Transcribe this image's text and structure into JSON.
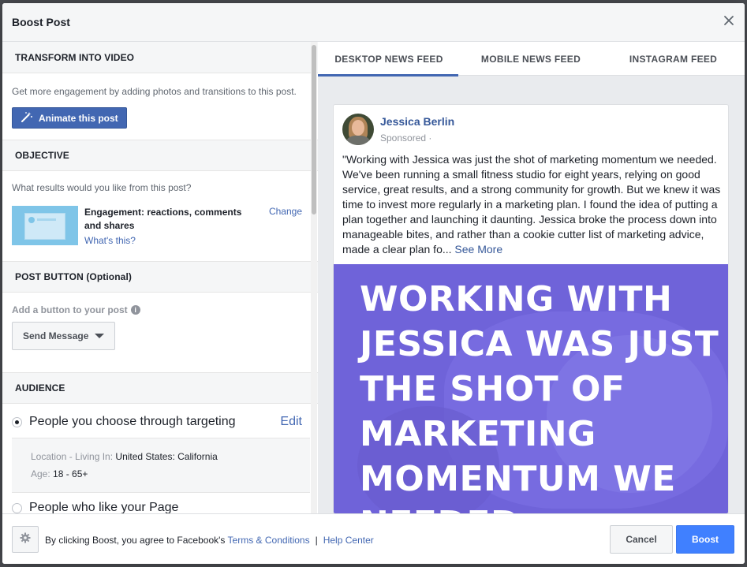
{
  "dialog": {
    "title": "Boost Post"
  },
  "transform": {
    "heading": "TRANSFORM INTO VIDEO",
    "description": "Get more engagement by adding photos and transitions to this post.",
    "animate_label": "Animate this post"
  },
  "objective": {
    "heading": "OBJECTIVE",
    "question": "What results would you like from this post?",
    "title": "Engagement: reactions, comments and shares",
    "whats_this": "What's this?",
    "change": "Change"
  },
  "post_button": {
    "heading": "POST BUTTON (Optional)",
    "label": "Add a button to your post",
    "selected": "Send Message"
  },
  "audience": {
    "heading": "AUDIENCE",
    "option1": "People you choose through targeting",
    "edit": "Edit",
    "location_key": "Location - Living In:",
    "location_value": "United States: California",
    "age_key": "Age:",
    "age_value": "18 - 65+",
    "option2": "People who like your Page"
  },
  "tabs": [
    "DESKTOP NEWS FEED",
    "MOBILE NEWS FEED",
    "INSTAGRAM FEED"
  ],
  "post": {
    "author": "Jessica Berlin",
    "meta": "Sponsored ·",
    "text": "\"Working with Jessica was just the shot of marketing momentum we needed. We've been running a small fitness studio for eight years, relying on good service, great results, and a strong community for growth. But we knew it was time to invest more regularly in a marketing plan. I found the idea of putting a plan together and launching it daunting. Jessica broke the process down into manageable bites, and rather than a cookie cutter list of marketing advice, made a clear plan fo...",
    "see_more": "See More",
    "image_text": "WORKING WITH JESSICA WAS JUST THE SHOT OF MARKETING MOMENTUM WE NEEDED"
  },
  "footer": {
    "agree_prefix": "By clicking Boost, you agree to Facebook's",
    "terms": "Terms & Conditions",
    "separator": "|",
    "help": "Help Center",
    "cancel": "Cancel",
    "boost": "Boost"
  },
  "colors": {
    "accent": "#4267b2",
    "boost": "#4080ff",
    "image_bg": "#6f63d9"
  }
}
